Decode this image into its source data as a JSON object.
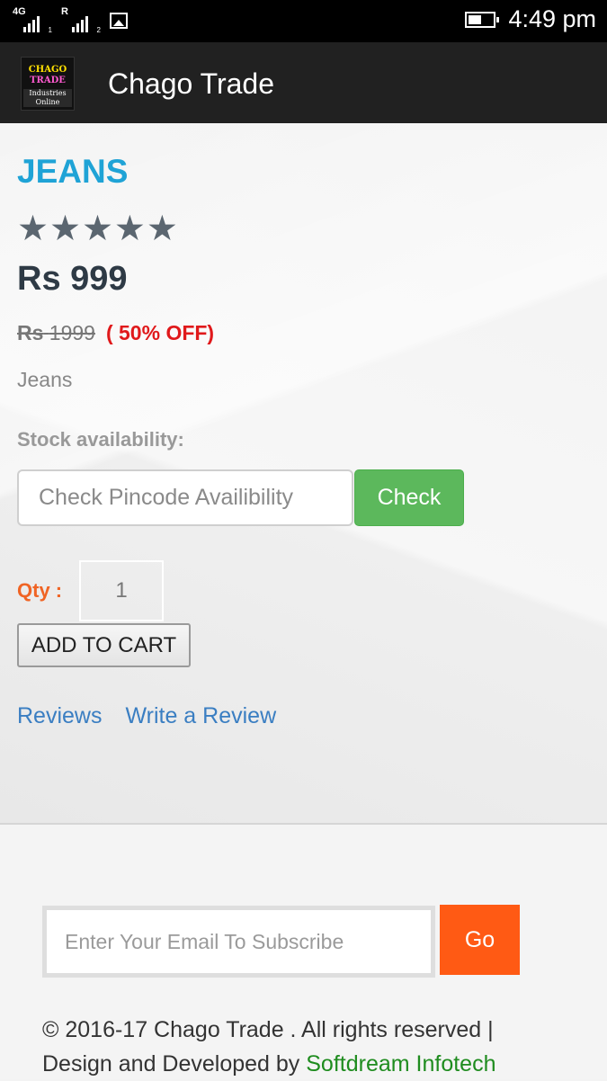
{
  "status_bar": {
    "network1_label": "4G",
    "network2_label": "R",
    "time": "4:49 pm",
    "icons": [
      "signal-icon",
      "signal-icon",
      "image-icon",
      "battery-icon"
    ]
  },
  "app_bar": {
    "logo_text_1": "CHAGO",
    "logo_text_2": "TRADE",
    "logo_text_3": "Industries Online",
    "title": "Chago Trade"
  },
  "product": {
    "name": "JEANS",
    "rating_stars": 5,
    "price": "Rs 999",
    "old_price_currency": "Rs",
    "old_price_value": "1999",
    "discount": "( 50% OFF)",
    "description": "Jeans",
    "stock_label": "Stock availability:",
    "pincode_placeholder": "Check Pincode Availibility",
    "check_label": "Check",
    "qty_label": "Qty :",
    "qty_value": "1",
    "add_to_cart_label": "ADD TO CART",
    "reviews_link": "Reviews",
    "write_review_link": "Write a Review"
  },
  "footer": {
    "subscribe_placeholder": "Enter Your Email To Subscribe",
    "go_label": "Go",
    "copyright": "© 2016-17 Chago Trade . All rights reserved |",
    "design_prefix": "Design and Developed by ",
    "developer": "Softdream Infotech"
  },
  "colors": {
    "accent_title": "#1fa3d6",
    "check_button": "#5cb85c",
    "discount": "#e0191b",
    "go_button": "#ff5a14",
    "qty_label": "#f06424",
    "link": "#3a7ec2",
    "developer_link": "#1f8c1f"
  }
}
